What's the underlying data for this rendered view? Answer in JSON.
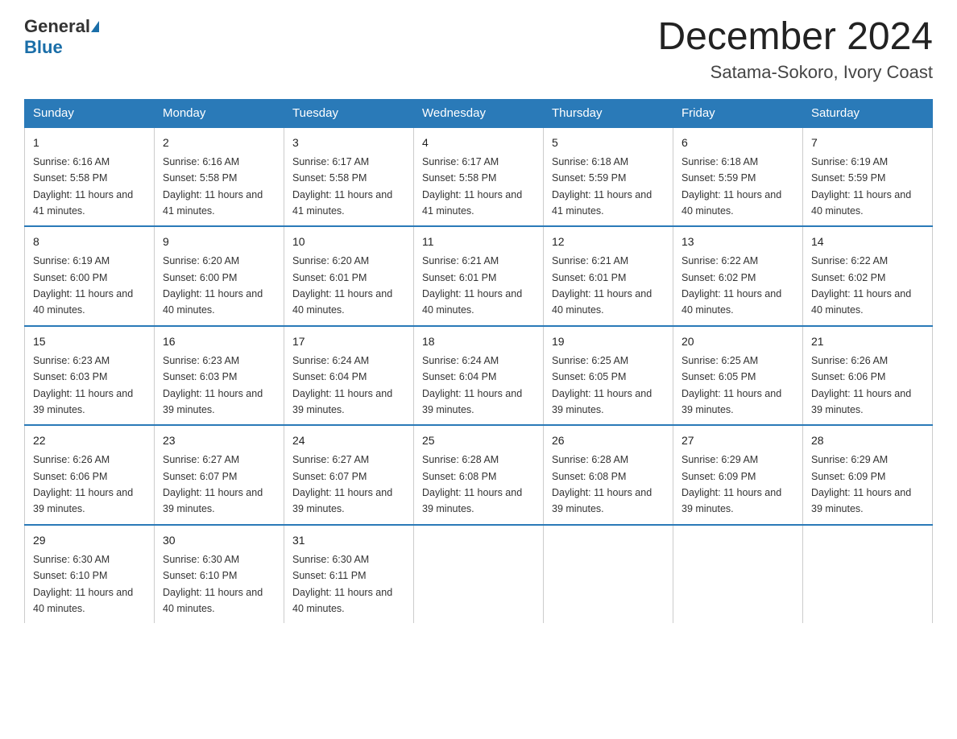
{
  "header": {
    "logo_general": "General",
    "logo_blue": "Blue",
    "month_title": "December 2024",
    "location": "Satama-Sokoro, Ivory Coast"
  },
  "days_of_week": [
    "Sunday",
    "Monday",
    "Tuesday",
    "Wednesday",
    "Thursday",
    "Friday",
    "Saturday"
  ],
  "weeks": [
    [
      {
        "day": "1",
        "sunrise": "6:16 AM",
        "sunset": "5:58 PM",
        "daylight": "11 hours and 41 minutes."
      },
      {
        "day": "2",
        "sunrise": "6:16 AM",
        "sunset": "5:58 PM",
        "daylight": "11 hours and 41 minutes."
      },
      {
        "day": "3",
        "sunrise": "6:17 AM",
        "sunset": "5:58 PM",
        "daylight": "11 hours and 41 minutes."
      },
      {
        "day": "4",
        "sunrise": "6:17 AM",
        "sunset": "5:58 PM",
        "daylight": "11 hours and 41 minutes."
      },
      {
        "day": "5",
        "sunrise": "6:18 AM",
        "sunset": "5:59 PM",
        "daylight": "11 hours and 41 minutes."
      },
      {
        "day": "6",
        "sunrise": "6:18 AM",
        "sunset": "5:59 PM",
        "daylight": "11 hours and 40 minutes."
      },
      {
        "day": "7",
        "sunrise": "6:19 AM",
        "sunset": "5:59 PM",
        "daylight": "11 hours and 40 minutes."
      }
    ],
    [
      {
        "day": "8",
        "sunrise": "6:19 AM",
        "sunset": "6:00 PM",
        "daylight": "11 hours and 40 minutes."
      },
      {
        "day": "9",
        "sunrise": "6:20 AM",
        "sunset": "6:00 PM",
        "daylight": "11 hours and 40 minutes."
      },
      {
        "day": "10",
        "sunrise": "6:20 AM",
        "sunset": "6:01 PM",
        "daylight": "11 hours and 40 minutes."
      },
      {
        "day": "11",
        "sunrise": "6:21 AM",
        "sunset": "6:01 PM",
        "daylight": "11 hours and 40 minutes."
      },
      {
        "day": "12",
        "sunrise": "6:21 AM",
        "sunset": "6:01 PM",
        "daylight": "11 hours and 40 minutes."
      },
      {
        "day": "13",
        "sunrise": "6:22 AM",
        "sunset": "6:02 PM",
        "daylight": "11 hours and 40 minutes."
      },
      {
        "day": "14",
        "sunrise": "6:22 AM",
        "sunset": "6:02 PM",
        "daylight": "11 hours and 40 minutes."
      }
    ],
    [
      {
        "day": "15",
        "sunrise": "6:23 AM",
        "sunset": "6:03 PM",
        "daylight": "11 hours and 39 minutes."
      },
      {
        "day": "16",
        "sunrise": "6:23 AM",
        "sunset": "6:03 PM",
        "daylight": "11 hours and 39 minutes."
      },
      {
        "day": "17",
        "sunrise": "6:24 AM",
        "sunset": "6:04 PM",
        "daylight": "11 hours and 39 minutes."
      },
      {
        "day": "18",
        "sunrise": "6:24 AM",
        "sunset": "6:04 PM",
        "daylight": "11 hours and 39 minutes."
      },
      {
        "day": "19",
        "sunrise": "6:25 AM",
        "sunset": "6:05 PM",
        "daylight": "11 hours and 39 minutes."
      },
      {
        "day": "20",
        "sunrise": "6:25 AM",
        "sunset": "6:05 PM",
        "daylight": "11 hours and 39 minutes."
      },
      {
        "day": "21",
        "sunrise": "6:26 AM",
        "sunset": "6:06 PM",
        "daylight": "11 hours and 39 minutes."
      }
    ],
    [
      {
        "day": "22",
        "sunrise": "6:26 AM",
        "sunset": "6:06 PM",
        "daylight": "11 hours and 39 minutes."
      },
      {
        "day": "23",
        "sunrise": "6:27 AM",
        "sunset": "6:07 PM",
        "daylight": "11 hours and 39 minutes."
      },
      {
        "day": "24",
        "sunrise": "6:27 AM",
        "sunset": "6:07 PM",
        "daylight": "11 hours and 39 minutes."
      },
      {
        "day": "25",
        "sunrise": "6:28 AM",
        "sunset": "6:08 PM",
        "daylight": "11 hours and 39 minutes."
      },
      {
        "day": "26",
        "sunrise": "6:28 AM",
        "sunset": "6:08 PM",
        "daylight": "11 hours and 39 minutes."
      },
      {
        "day": "27",
        "sunrise": "6:29 AM",
        "sunset": "6:09 PM",
        "daylight": "11 hours and 39 minutes."
      },
      {
        "day": "28",
        "sunrise": "6:29 AM",
        "sunset": "6:09 PM",
        "daylight": "11 hours and 39 minutes."
      }
    ],
    [
      {
        "day": "29",
        "sunrise": "6:30 AM",
        "sunset": "6:10 PM",
        "daylight": "11 hours and 40 minutes."
      },
      {
        "day": "30",
        "sunrise": "6:30 AM",
        "sunset": "6:10 PM",
        "daylight": "11 hours and 40 minutes."
      },
      {
        "day": "31",
        "sunrise": "6:30 AM",
        "sunset": "6:11 PM",
        "daylight": "11 hours and 40 minutes."
      },
      null,
      null,
      null,
      null
    ]
  ]
}
